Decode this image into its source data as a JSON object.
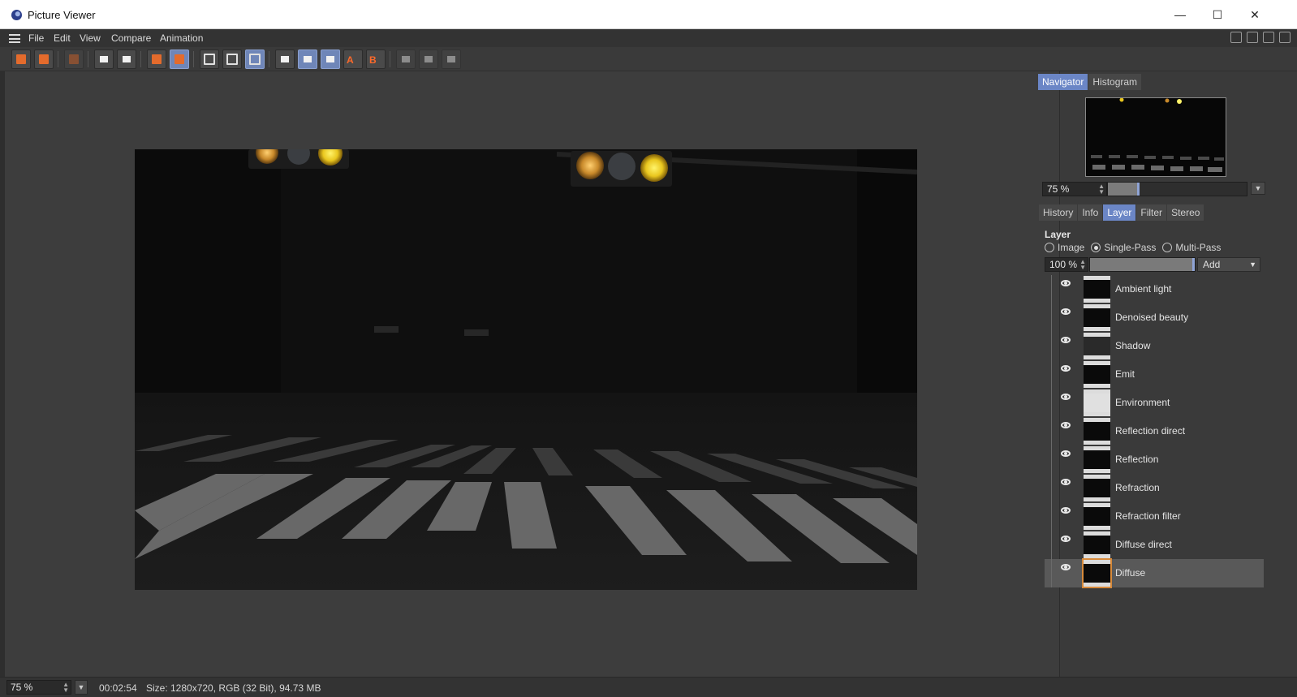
{
  "window": {
    "title": "Picture Viewer"
  },
  "menu": [
    "File",
    "Edit",
    "View",
    "Compare",
    "Animation"
  ],
  "navigator": {
    "tabs": [
      "Navigator",
      "Histogram"
    ],
    "active_tab": "Navigator",
    "zoom": "75 %"
  },
  "panel_tabs": {
    "tabs": [
      "History",
      "Info",
      "Layer",
      "Filter",
      "Stereo"
    ],
    "active_tab": "Layer"
  },
  "layer_panel": {
    "heading": "Layer",
    "modes": [
      "Image",
      "Single-Pass",
      "Multi-Pass"
    ],
    "selected_mode": "Single-Pass",
    "opacity": "100 %",
    "blend": "Add",
    "layers": [
      {
        "name": "Ambient light"
      },
      {
        "name": "Denoised beauty"
      },
      {
        "name": "Shadow"
      },
      {
        "name": "Emit"
      },
      {
        "name": "Environment"
      },
      {
        "name": "Reflection direct"
      },
      {
        "name": "Reflection"
      },
      {
        "name": "Refraction"
      },
      {
        "name": "Refraction filter"
      },
      {
        "name": "Diffuse direct"
      },
      {
        "name": "Diffuse"
      }
    ],
    "selected_layer": "Diffuse"
  },
  "status": {
    "zoom": "75 %",
    "time": "00:02:54",
    "size": "Size: 1280x720, RGB (32 Bit), 94.73 MB"
  },
  "colors": {
    "accent": "#6b86c6",
    "icon_orange": "#e46b2c",
    "background": "#3a3a3a"
  }
}
